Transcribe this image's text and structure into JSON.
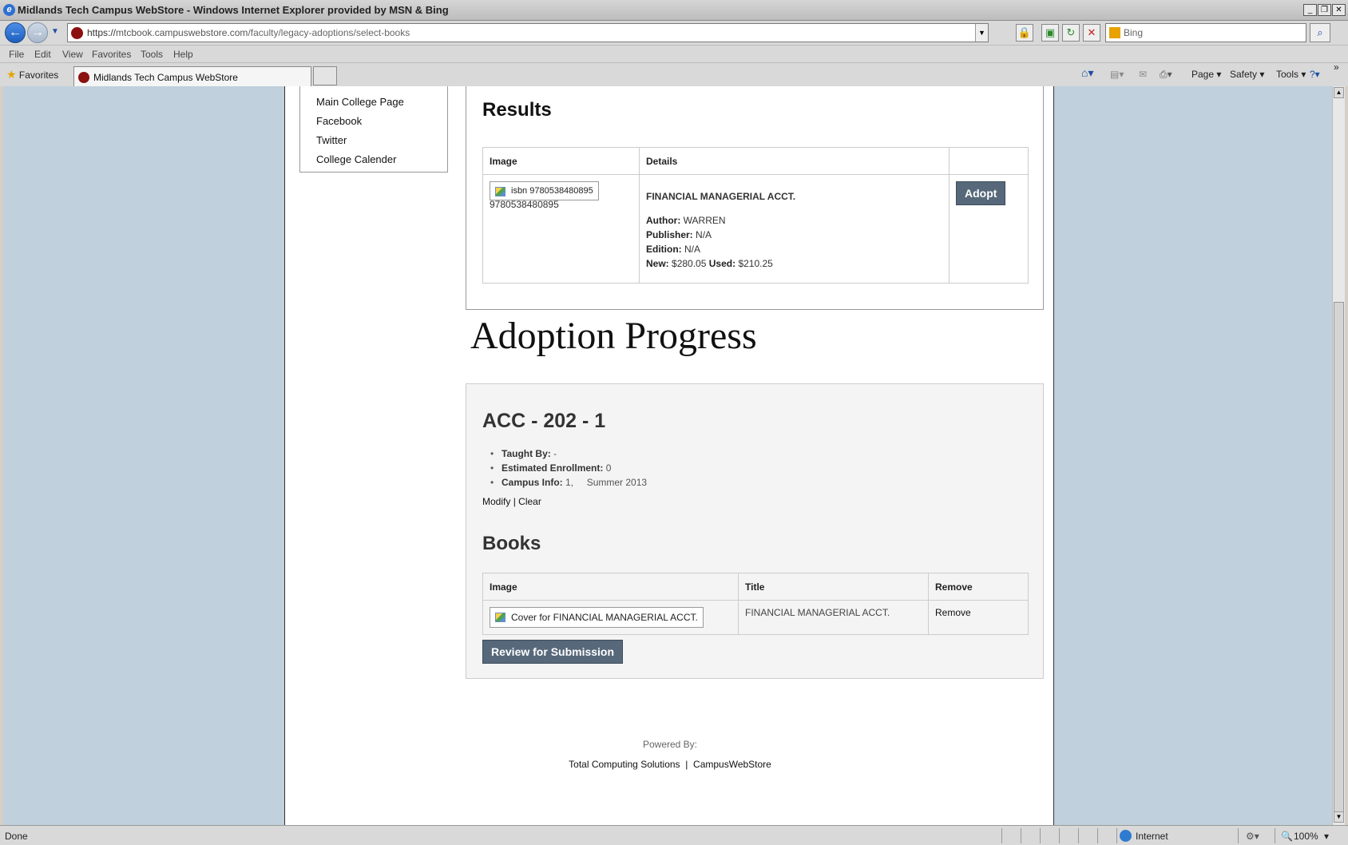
{
  "browser": {
    "window_title": "Midlands Tech Campus WebStore - Windows Internet Explorer provided by MSN & Bing",
    "address_prefix": "https://",
    "address_host": "mtcbook.campuswebstore.com",
    "address_path": "/faculty/legacy-adoptions/select-books",
    "search_placeholder": "Bing",
    "menu": [
      "File",
      "Edit",
      "View",
      "Favorites",
      "Tools",
      "Help"
    ],
    "favorites_label": "Favorites",
    "tab_title": "Midlands Tech Campus WebStore",
    "command_bar": {
      "page": "Page",
      "safety": "Safety",
      "tools": "Tools"
    },
    "status": {
      "text": "Done",
      "zone": "Internet",
      "zoom": "100%"
    }
  },
  "sidebar": {
    "links": [
      "Main College Page",
      "Facebook",
      "Twitter",
      "College Calender"
    ]
  },
  "results": {
    "heading": "Results",
    "columns": [
      "Image",
      "Details",
      ""
    ],
    "row": {
      "image_alt": "isbn 9780538480895",
      "isbn": "9780538480895",
      "title": "FINANCIAL MANAGERIAL ACCT.",
      "author_label": "Author:",
      "author": "WARREN",
      "publisher_label": "Publisher:",
      "publisher": "N/A",
      "edition_label": "Edition:",
      "edition": "N/A",
      "new_label": "New:",
      "new_price": "$280.05",
      "used_label": "Used:",
      "used_price": "$210.25",
      "adopt_label": "Adopt"
    }
  },
  "adoption": {
    "heading": "Adoption Progress",
    "course": "ACC - 202 - 1",
    "taught_by_label": "Taught By:",
    "taught_by": "-",
    "enrollment_label": "Estimated Enrollment:",
    "enrollment": "0",
    "campus_label": "Campus Info:",
    "campus": "1,     Summer 2013",
    "modify": "Modify",
    "separator": "|",
    "clear": "Clear",
    "books_heading": "Books",
    "books_columns": [
      "Image",
      "Title",
      "Remove"
    ],
    "book": {
      "image_alt": "Cover for FINANCIAL MANAGERIAL ACCT.",
      "title": "FINANCIAL MANAGERIAL ACCT.",
      "remove": "Remove"
    },
    "review_button": "Review for Submission"
  },
  "footer": {
    "powered_by": "Powered By:",
    "link1": "Total Computing Solutions",
    "separator": "|",
    "link2": "CampusWebStore"
  }
}
